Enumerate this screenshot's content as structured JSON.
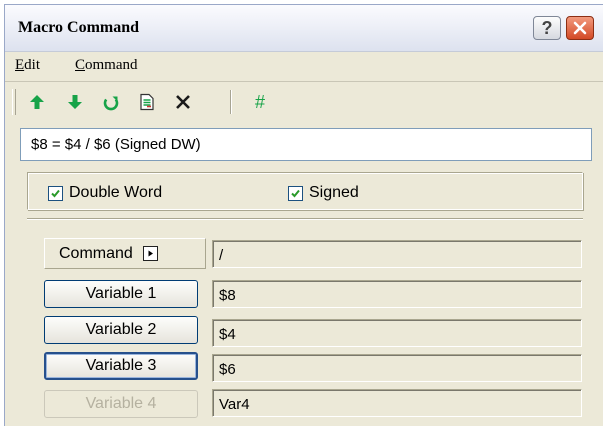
{
  "window": {
    "title": "Macro Command"
  },
  "titlebar": {
    "help_label": "?"
  },
  "menu": [
    {
      "mnemonic": "E",
      "rest": "dit"
    },
    {
      "mnemonic": "C",
      "rest": "ommand"
    }
  ],
  "toolbar": {
    "icons": [
      "arrow-up-icon",
      "arrow-down-icon",
      "refresh-icon",
      "document-icon",
      "delete-icon",
      "hash-icon"
    ],
    "hash_label": "#"
  },
  "expression": "$8 = $4 / $6 (Signed DW)",
  "options": {
    "double_word": {
      "label": "Double Word",
      "checked": true
    },
    "signed": {
      "label": "Signed",
      "checked": true
    }
  },
  "command": {
    "label": "Command",
    "value": "/"
  },
  "variables": [
    {
      "label": "Variable 1",
      "value": "$8",
      "enabled": true
    },
    {
      "label": "Variable 2",
      "value": "$4",
      "enabled": true
    },
    {
      "label": "Variable 3",
      "value": "$6",
      "enabled": true,
      "focused": true
    },
    {
      "label": "Variable 4",
      "value": "Var4",
      "enabled": false
    }
  ],
  "colors": {
    "toolbar_green": "#17a348",
    "delete_dark": "#1a1a1a",
    "close_red": "#d34a26",
    "check_green": "#2a9a2a"
  }
}
